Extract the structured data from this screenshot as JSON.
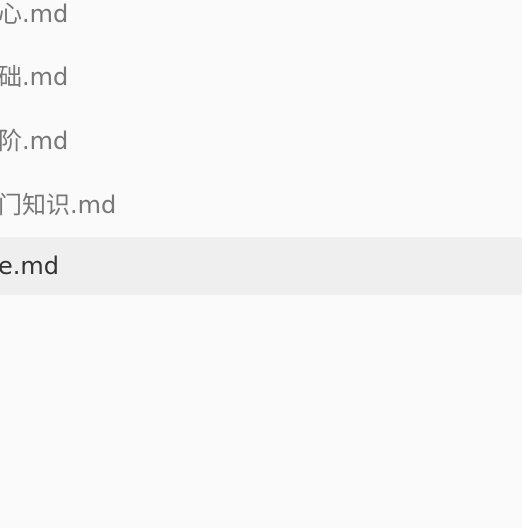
{
  "file_tree": {
    "items": [
      {
        "name": "心.md",
        "active": false
      },
      {
        "name": "础.md",
        "active": false
      },
      {
        "name": "阶.md",
        "active": false
      },
      {
        "name": "门知识.md",
        "active": false
      },
      {
        "name": "e.md",
        "active": true
      }
    ]
  },
  "colors": {
    "background": "#fafafa",
    "active_row": "#efefef",
    "text": "#777777",
    "active_text": "#333333"
  }
}
